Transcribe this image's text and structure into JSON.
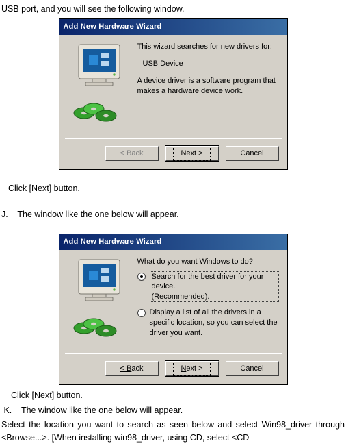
{
  "intro_line": "USB port, and you will see the following window.",
  "dlg1": {
    "title": "Add New Hardware Wizard",
    "line1": "This wizard searches for new drivers for:",
    "device": "USB Device",
    "line2": "A device driver is a software program that makes a hardware device work.",
    "back": "< Back",
    "next": "Next >",
    "cancel": "Cancel"
  },
  "after1": "Click [Next] button.",
  "stepJ": "J.    The window like the one below will appear.",
  "dlg2": {
    "title": "Add New Hardware Wizard",
    "prompt": "What do you want Windows to do?",
    "opt1a": "Search for the best driver for your device.",
    "opt1b": "(Recommended).",
    "opt2": "Display a list of all the drivers in a specific location, so you can select the driver you want.",
    "back": "< Back",
    "next": "Next >",
    "cancel": "Cancel"
  },
  "after2a": "Click [Next] button.",
  "stepK": " K.    The window like the one below will appear.",
  "after2b": "Select the location you want to search as seen below and select Win98_driver through <Browse...>. [When installing win98_driver, using CD, select <CD-",
  "chart_data": null
}
